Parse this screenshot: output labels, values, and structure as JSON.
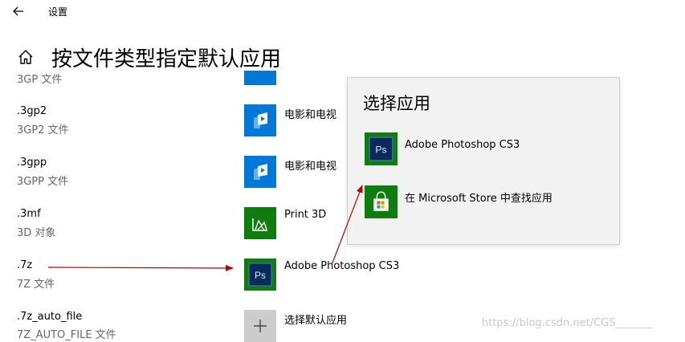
{
  "window": {
    "title": "设置"
  },
  "page": {
    "title": "按文件类型指定默认应用"
  },
  "rows": [
    {
      "ext": "",
      "desc": "3GP 文件",
      "app": ""
    },
    {
      "ext": ".3gp2",
      "desc": "3GP2 文件",
      "app": "电影和电视"
    },
    {
      "ext": ".3gpp",
      "desc": "3GPP 文件",
      "app": "电影和电视"
    },
    {
      "ext": ".3mf",
      "desc": "3D 对象",
      "app": "Print 3D"
    },
    {
      "ext": ".7z",
      "desc": "7Z 文件",
      "app": "Adobe Photoshop CS3"
    },
    {
      "ext": ".7z_auto_file",
      "desc": "7Z_AUTO_FILE 文件",
      "app": "选择默认应用"
    }
  ],
  "flyout": {
    "title": "选择应用",
    "items": [
      {
        "label": "Adobe Photoshop CS3",
        "icon": "photoshop-icon"
      },
      {
        "label": "在 Microsoft Store 中查找应用",
        "icon": "store-icon"
      }
    ]
  },
  "icons": {
    "movies": "movies-tv-icon",
    "print3d": "print-3d-icon",
    "photoshop": "photoshop-icon",
    "add": "plus-icon"
  },
  "colors": {
    "blue_tile": "#0078d7",
    "green_tile": "#107c10",
    "gray_tile": "#cccccc",
    "arrow": "#c00000"
  },
  "watermark": "https://blog.csdn.net/CGS_______"
}
